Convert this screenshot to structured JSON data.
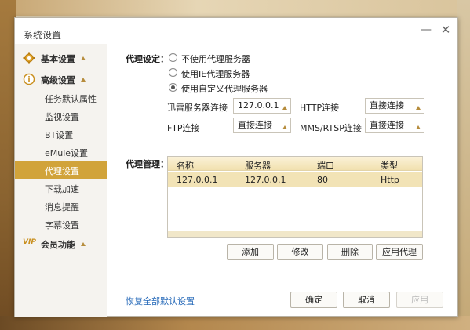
{
  "window": {
    "title": "系统设置",
    "minimize_glyph": "—",
    "close_glyph": "✕"
  },
  "sidebar": {
    "groups": [
      {
        "label": "基本设置",
        "icon": "gear-icon"
      },
      {
        "label": "高级设置",
        "icon": "info-icon"
      },
      {
        "label": "会员功能",
        "icon": "vip-icon",
        "icon_text": "VIP"
      }
    ],
    "items": [
      {
        "label": "任务默认属性"
      },
      {
        "label": "监视设置"
      },
      {
        "label": "BT设置"
      },
      {
        "label": "eMule设置"
      },
      {
        "label": "代理设置",
        "active": true
      },
      {
        "label": "下载加速"
      },
      {
        "label": "消息提醒"
      },
      {
        "label": "字幕设置"
      }
    ]
  },
  "proxy_settings": {
    "label": "代理设定：",
    "options": [
      {
        "label": "不使用代理服务器",
        "checked": false
      },
      {
        "label": "使用IE代理服务器",
        "checked": false
      },
      {
        "label": "使用自定义代理服务器",
        "checked": true
      }
    ],
    "rows": [
      {
        "label": "迅雷服务器连接",
        "value": "127.0.0.1"
      },
      {
        "label": "HTTP连接",
        "value": "直接连接"
      },
      {
        "label": "FTP连接",
        "value": "直接连接"
      },
      {
        "label": "MMS/RTSP连接",
        "value": "直接连接"
      }
    ]
  },
  "proxy_manage": {
    "label": "代理管理：",
    "columns": [
      "名称",
      "服务器",
      "端口",
      "类型"
    ],
    "rows": [
      {
        "name": "127.0.0.1",
        "server": "127.0.0.1",
        "port": "80",
        "type": "Http"
      }
    ],
    "buttons": {
      "add": "添加",
      "edit": "修改",
      "delete": "删除",
      "apply_proxy": "应用代理"
    }
  },
  "footer": {
    "restore_link": "恢复全部默认设置",
    "ok": "确定",
    "cancel": "取消",
    "apply": "应用"
  },
  "colors": {
    "accent": "#d1a33a",
    "link": "#2468b8",
    "selected_row": "#f2e3b6"
  }
}
